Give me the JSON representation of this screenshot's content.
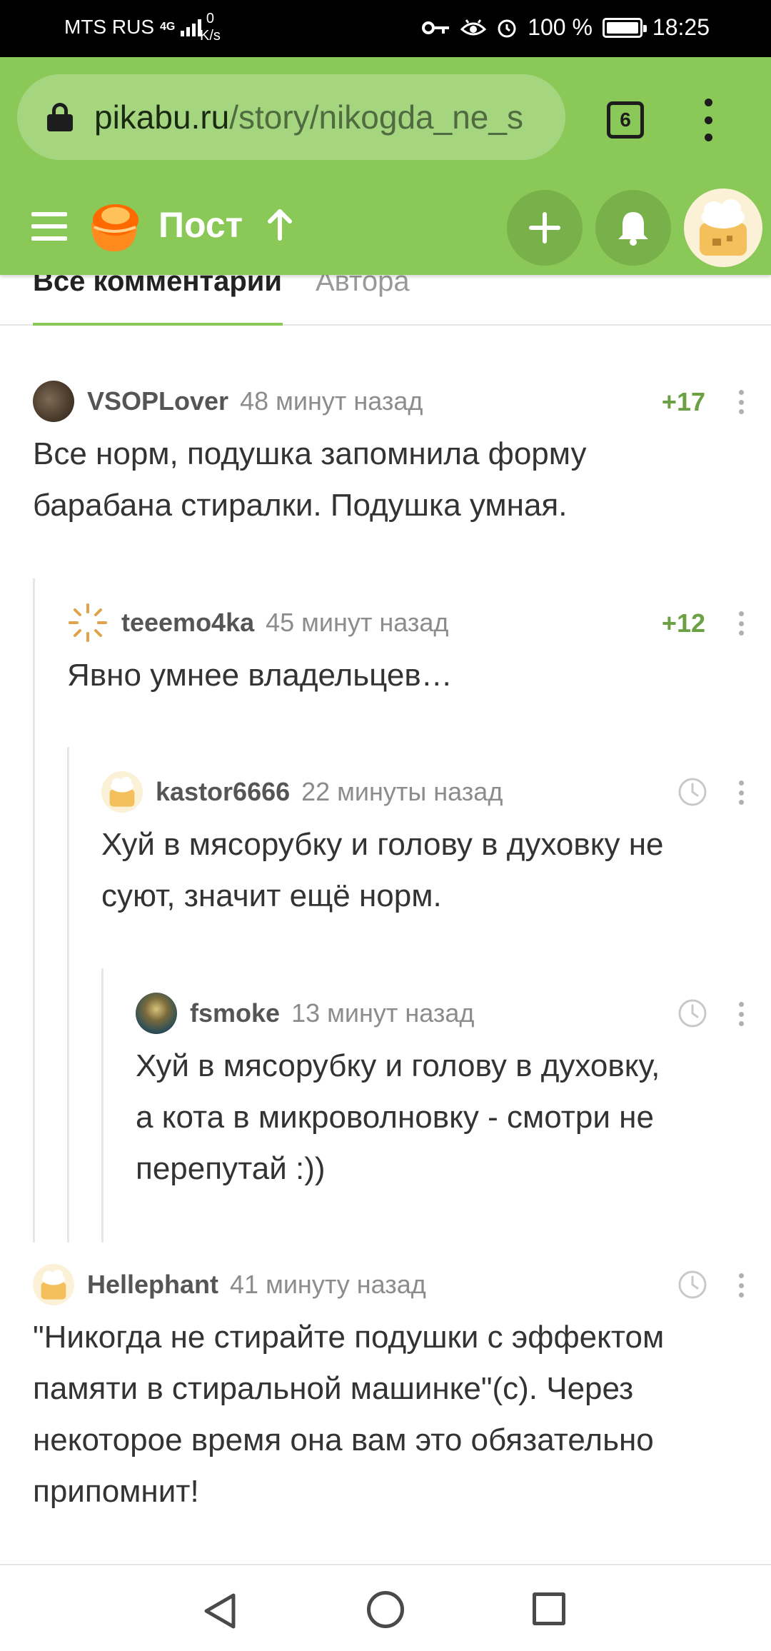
{
  "status_bar": {
    "carrier": "MTS RUS",
    "network_type": "4G",
    "speed_value": "0",
    "speed_unit": "K/s",
    "battery": "100 %",
    "battery_level": 1.0,
    "time": "18:25"
  },
  "browser": {
    "url_host": "pikabu.ru",
    "url_path": "/story/nikogda_ne_s",
    "tab_count": "6"
  },
  "header": {
    "title": "Пост"
  },
  "tabs": {
    "all_comments": "Все комментарии",
    "author": "Автора"
  },
  "comments": [
    {
      "user": "VSOPLover",
      "time": "48 минут назад",
      "rating": "+17",
      "lines": [
        "Все норм, подушка запомнила форму",
        "барабана стиралки. Подушка умная."
      ]
    },
    {
      "user": "teeemo4ka",
      "time": "45 минут назад",
      "rating": "+12",
      "lines": [
        "Явно умнее владельцев…"
      ]
    },
    {
      "user": "kastor6666",
      "time": "22 минуты назад",
      "rating": "",
      "lines": [
        "Хуй в мясорубку и голову в духовку не",
        "суют, значит ещё норм."
      ]
    },
    {
      "user": "fsmoke",
      "time": "13 минут назад",
      "rating": "",
      "lines": [
        "Хуй в мясорубку и голову в духовку,",
        "а кота в микроволновку - смотри не",
        "перепутай :))"
      ]
    },
    {
      "user": "Hellephant",
      "time": "41 минуту назад",
      "rating": "",
      "lines": [
        "\"Никогда не стирайте подушки с эффектом",
        "памяти в стиральной машинке\"(с). Через",
        "некоторое время она вам это обязательно",
        "припомнит!"
      ]
    }
  ],
  "colors": {
    "brand_green": "#8ac858",
    "rating_green": "#6ba043"
  },
  "icons": [
    "lock-icon",
    "tabs-icon",
    "menu-icon",
    "pikabu-logo-icon",
    "arrow-up-icon",
    "plus-icon",
    "bell-icon",
    "clock-icon",
    "more-icon",
    "back-icon",
    "home-icon",
    "recent-apps-icon"
  ]
}
